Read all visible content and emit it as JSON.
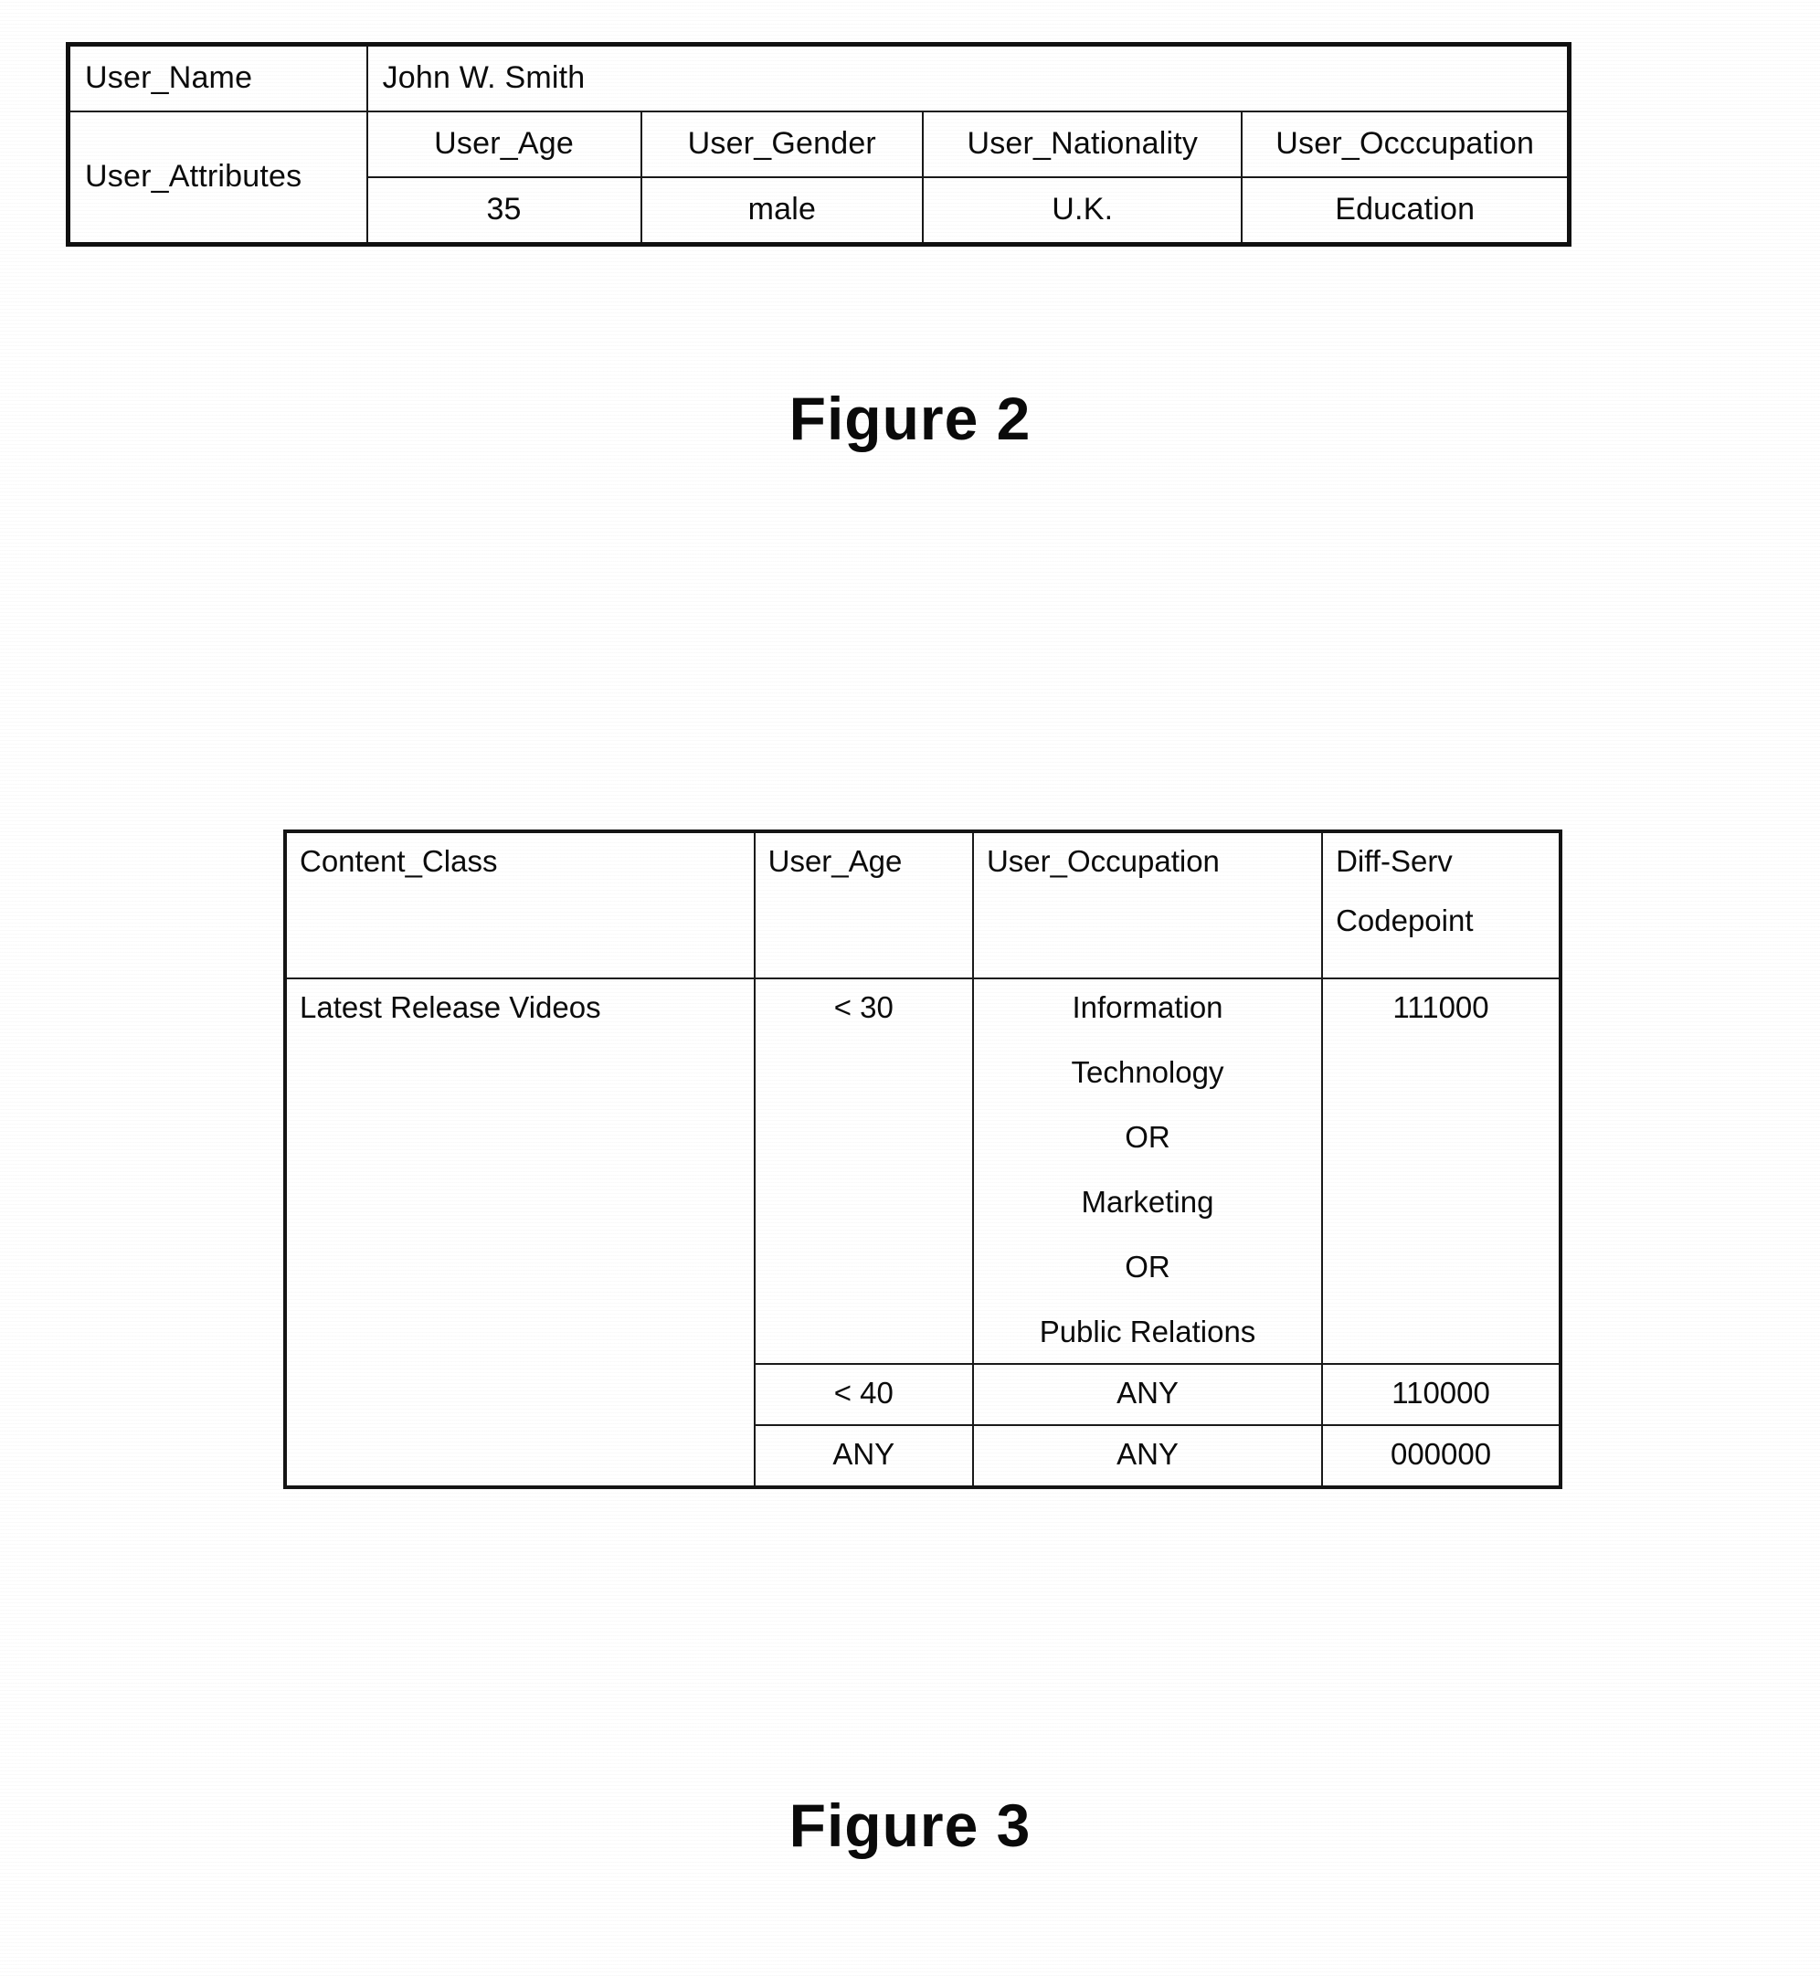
{
  "document": {
    "kind": "patent-figure-sheet",
    "background_color": "#ffffff",
    "ink_color": "#000000"
  },
  "figure2": {
    "caption": "Figure 2",
    "row_label_user_name": "User_Name",
    "value_user_name": "John W. Smith",
    "row_label_user_attributes": "User_Attributes",
    "attribute_headers": [
      "User_Age",
      "User_Gender",
      "User_Nationality",
      "User_Occcupation"
    ],
    "attribute_values": [
      "35",
      "male",
      "U.K.",
      "Education"
    ]
  },
  "figure3": {
    "caption": "Figure 3",
    "headers": {
      "content_class": "Content_Class",
      "user_age": "User_Age",
      "user_occupation": "User_Occupation",
      "diff_serv_line1": "Diff-Serv",
      "diff_serv_line2": "Codepoint"
    },
    "rows": [
      {
        "content_class": "Latest Release Videos",
        "user_age": "< 30",
        "user_occupation_lines": [
          "Information",
          "Technology",
          "OR",
          "Marketing",
          "OR",
          "Public Relations"
        ],
        "diff_serv_codepoint": "111000"
      },
      {
        "content_class": "",
        "user_age": "< 40",
        "user_occupation_lines": [
          "ANY"
        ],
        "diff_serv_codepoint": "110000"
      },
      {
        "content_class": "",
        "user_age": "ANY",
        "user_occupation_lines": [
          "ANY"
        ],
        "diff_serv_codepoint": "000000"
      }
    ]
  }
}
